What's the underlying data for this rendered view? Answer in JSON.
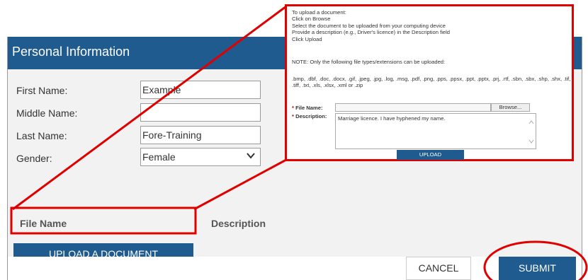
{
  "panel": {
    "title": "Personal Information",
    "fields": {
      "first_name_label": "First Name:",
      "first_name_value": "Example",
      "middle_name_label": "Middle Name:",
      "middle_name_value": "",
      "last_name_label": "Last Name:",
      "last_name_value": "Fore-Training",
      "gender_label": "Gender:",
      "gender_value": "Female"
    },
    "columns": {
      "file_name": "File Name",
      "description": "Description"
    },
    "upload_button": "UPLOAD A DOCUMENT",
    "cancel_button": "CANCEL",
    "submit_button": "SUBMIT"
  },
  "callout": {
    "instructions": [
      "To upload a document:",
      "Click on Browse",
      "Select the document to be uploaded from your computing device",
      "Provide a description (e.g., Driver's licence) in the Description field",
      "Click Upload"
    ],
    "note": "NOTE: Only the following file types/extensions can be uploaded:",
    "file_types": ".bmp, .dbf, .doc, .docx, .gif, .jpeg, .jpg, .log, .msg, .pdf, .png, .pps, .ppsx, .ppt, .pptx, .prj, .rtf, .sbn, .sbx, .shp, .shx, .tif, .tiff, .txt, .xls, .xlsx, .xml or .zip",
    "required_mark": "*",
    "file_name_label": "File Name:",
    "browse_button": "Browse...",
    "description_label": "Description:",
    "description_value": "Marriage licence. I have hyphened my name.",
    "upload_button": "UPLOAD"
  },
  "colors": {
    "header_blue": "#1f5b8e",
    "annotation_red": "#e00000",
    "form_background": "#f2f2f2"
  }
}
